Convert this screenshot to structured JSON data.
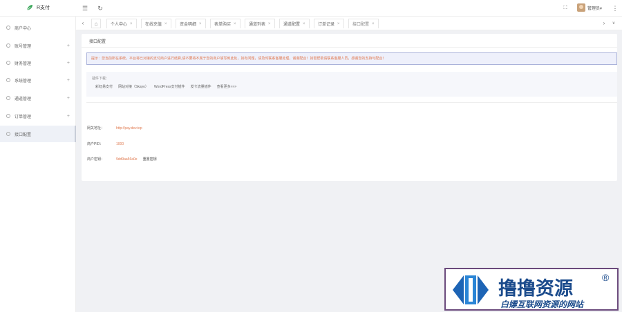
{
  "header": {
    "app_name": "R支付",
    "user_label": "管理员▾",
    "menu_icon": "menu-fold-icon",
    "refresh_icon": "refresh-icon",
    "fullscreen_icon": "fullscreen-icon",
    "more_icon": "more-icon"
  },
  "sidebar": {
    "items": [
      {
        "label": "商户中心",
        "icon": "home-icon",
        "expandable": false
      },
      {
        "label": "账号管理",
        "icon": "user-icon",
        "expandable": true
      },
      {
        "label": "财务管理",
        "icon": "finance-icon",
        "expandable": true
      },
      {
        "label": "系统管理",
        "icon": "settings-icon",
        "expandable": true
      },
      {
        "label": "通道管理",
        "icon": "channel-icon",
        "expandable": true
      },
      {
        "label": "订单管理",
        "icon": "order-icon",
        "expandable": true
      },
      {
        "label": "接口配置",
        "icon": "api-icon",
        "expandable": false
      }
    ]
  },
  "tabs": {
    "items": [
      {
        "label": "个人中心"
      },
      {
        "label": "在线充值"
      },
      {
        "label": "资金明细"
      },
      {
        "label": "表单购买"
      },
      {
        "label": "通道列表"
      },
      {
        "label": "通道配置"
      },
      {
        "label": "订单记录"
      },
      {
        "label": "接口配置"
      }
    ]
  },
  "card": {
    "title": "接口配置",
    "notice": "提示：您当前所在系统，平台将已对接的支付商户进行结算,请不要将不属于您的商户填写到此处，如有问题，请及时联系客服处理，谢谢配合！如需帮助请联系客服人员，感谢您的支持与配合！",
    "plugins_title": "插件下载：",
    "plugin_links": [
      "彩虹易支付",
      "网站对接（Skayo）",
      "WordPress支付插件",
      "发卡流量插件",
      "查看更多>>>"
    ],
    "fields": [
      {
        "label": "网关地址：",
        "value": "http://pay.dev.top"
      },
      {
        "label": "商户PID：",
        "value": "1000"
      },
      {
        "label": "商户密钥：",
        "value": "9dd9aa56a0e"
      }
    ],
    "reset_label": "重置密钥"
  },
  "watermark": {
    "title": "撸撸资源",
    "subtitle": "白嫖互联网资源的网站",
    "registered": "®"
  },
  "colors": {
    "accent_orange": "#e07a50",
    "notice_bg": "#eef0fb",
    "notice_border": "#aab2da",
    "brand_blue": "#1b4b8c"
  }
}
